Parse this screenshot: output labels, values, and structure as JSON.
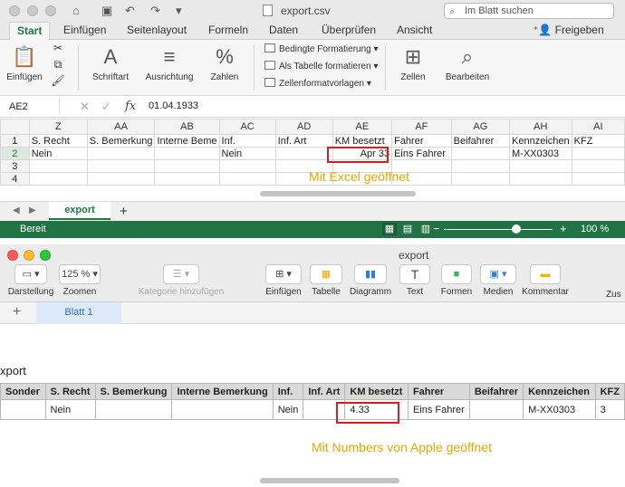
{
  "excel": {
    "window_title": "export.csv",
    "search_placeholder": "Im Blatt suchen",
    "tabs": [
      "Start",
      "Einfügen",
      "Seitenlayout",
      "Formeln",
      "Daten",
      "Überprüfen",
      "Ansicht"
    ],
    "share_label": "Freigeben",
    "ribbon": {
      "einfuegen": "Einfügen",
      "schriftart": "Schriftart",
      "ausrichtung": "Ausrichtung",
      "zahlen": "Zahlen",
      "bedingte": "Bedingte Formatierung",
      "als_tabelle": "Als Tabelle formatieren",
      "zellformat": "Zellenformatvorlagen",
      "zellen": "Zellen",
      "bearbeiten": "Bearbeiten"
    },
    "name_box": "AE2",
    "fx_label": "fx",
    "formula_value": "01.04.1933",
    "columns": [
      "Z",
      "AA",
      "AB",
      "AC",
      "AD",
      "AE",
      "AF",
      "AG",
      "AH",
      "AI"
    ],
    "rows": [
      {
        "num": "1",
        "cells": [
          "S. Recht",
          "S. Bemerkung",
          "Interne Beme",
          "Inf.",
          "Inf. Art",
          "KM besetzt",
          "Fahrer",
          "Beifahrer",
          "Kennzeichen",
          "KFZ"
        ]
      },
      {
        "num": "2",
        "cells": [
          "Nein",
          "",
          "",
          "Nein",
          "",
          "Apr 33",
          "Eins Fahrer",
          "",
          "M-XX0303",
          ""
        ]
      },
      {
        "num": "3",
        "cells": [
          "",
          "",
          "",
          "",
          "",
          "",
          "",
          "",
          "",
          ""
        ]
      },
      {
        "num": "4",
        "cells": [
          "",
          "",
          "",
          "",
          "",
          "",
          "",
          "",
          "",
          ""
        ]
      }
    ],
    "annotation": "Mit Excel geöffnet",
    "sheet_tab": "export",
    "status_ready": "Bereit",
    "zoom_percent": "100 %",
    "zoom_level": 0.67
  },
  "numbers": {
    "window_title": "export",
    "toolbar": {
      "darstellung": "Darstellung",
      "zoom_value": "125 %",
      "zoomen": "Zoomen",
      "kategorie": "Kategorie hinzufügen",
      "einfuegen": "Einfügen",
      "tabelle": "Tabelle",
      "diagramm": "Diagramm",
      "text": "Text",
      "formen": "Formen",
      "medien": "Medien",
      "kommentar": "Kommentar",
      "zus": "Zus"
    },
    "sheet_tab": "Blatt 1",
    "table_title": "xport",
    "headers": [
      "Sonder",
      "S. Recht",
      "S. Bemerkung",
      "Interne Bemerkung",
      "Inf.",
      "Inf. Art",
      "KM besetzt",
      "Fahrer",
      "Beifahrer",
      "Kennzeichen",
      "KFZ"
    ],
    "row": [
      "",
      "Nein",
      "",
      "",
      "Nein",
      "",
      "4.33",
      "Eins Fahrer",
      "",
      "M-XX0303",
      "3"
    ],
    "annotation": "Mit Numbers von Apple geöffnet"
  }
}
